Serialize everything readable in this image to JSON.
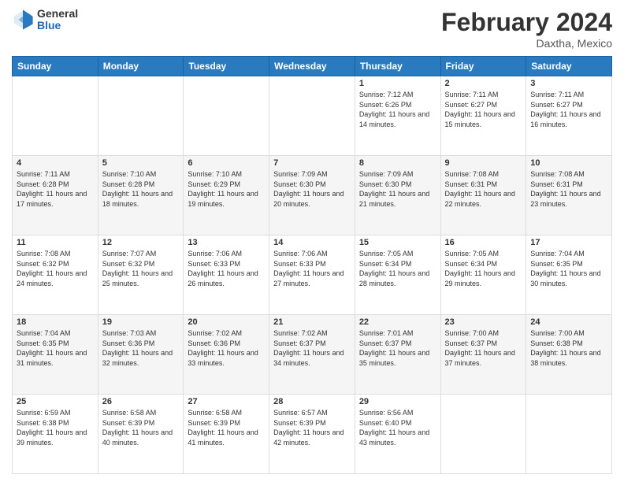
{
  "header": {
    "logo": {
      "general": "General",
      "blue": "Blue"
    },
    "title": "February 2024",
    "location": "Daxtha, Mexico"
  },
  "days_of_week": [
    "Sunday",
    "Monday",
    "Tuesday",
    "Wednesday",
    "Thursday",
    "Friday",
    "Saturday"
  ],
  "weeks": [
    [
      {
        "day": "",
        "info": ""
      },
      {
        "day": "",
        "info": ""
      },
      {
        "day": "",
        "info": ""
      },
      {
        "day": "",
        "info": ""
      },
      {
        "day": "1",
        "info": "Sunrise: 7:12 AM\nSunset: 6:26 PM\nDaylight: 11 hours and 14 minutes."
      },
      {
        "day": "2",
        "info": "Sunrise: 7:11 AM\nSunset: 6:27 PM\nDaylight: 11 hours and 15 minutes."
      },
      {
        "day": "3",
        "info": "Sunrise: 7:11 AM\nSunset: 6:27 PM\nDaylight: 11 hours and 16 minutes."
      }
    ],
    [
      {
        "day": "4",
        "info": "Sunrise: 7:11 AM\nSunset: 6:28 PM\nDaylight: 11 hours and 17 minutes."
      },
      {
        "day": "5",
        "info": "Sunrise: 7:10 AM\nSunset: 6:28 PM\nDaylight: 11 hours and 18 minutes."
      },
      {
        "day": "6",
        "info": "Sunrise: 7:10 AM\nSunset: 6:29 PM\nDaylight: 11 hours and 19 minutes."
      },
      {
        "day": "7",
        "info": "Sunrise: 7:09 AM\nSunset: 6:30 PM\nDaylight: 11 hours and 20 minutes."
      },
      {
        "day": "8",
        "info": "Sunrise: 7:09 AM\nSunset: 6:30 PM\nDaylight: 11 hours and 21 minutes."
      },
      {
        "day": "9",
        "info": "Sunrise: 7:08 AM\nSunset: 6:31 PM\nDaylight: 11 hours and 22 minutes."
      },
      {
        "day": "10",
        "info": "Sunrise: 7:08 AM\nSunset: 6:31 PM\nDaylight: 11 hours and 23 minutes."
      }
    ],
    [
      {
        "day": "11",
        "info": "Sunrise: 7:08 AM\nSunset: 6:32 PM\nDaylight: 11 hours and 24 minutes."
      },
      {
        "day": "12",
        "info": "Sunrise: 7:07 AM\nSunset: 6:32 PM\nDaylight: 11 hours and 25 minutes."
      },
      {
        "day": "13",
        "info": "Sunrise: 7:06 AM\nSunset: 6:33 PM\nDaylight: 11 hours and 26 minutes."
      },
      {
        "day": "14",
        "info": "Sunrise: 7:06 AM\nSunset: 6:33 PM\nDaylight: 11 hours and 27 minutes."
      },
      {
        "day": "15",
        "info": "Sunrise: 7:05 AM\nSunset: 6:34 PM\nDaylight: 11 hours and 28 minutes."
      },
      {
        "day": "16",
        "info": "Sunrise: 7:05 AM\nSunset: 6:34 PM\nDaylight: 11 hours and 29 minutes."
      },
      {
        "day": "17",
        "info": "Sunrise: 7:04 AM\nSunset: 6:35 PM\nDaylight: 11 hours and 30 minutes."
      }
    ],
    [
      {
        "day": "18",
        "info": "Sunrise: 7:04 AM\nSunset: 6:35 PM\nDaylight: 11 hours and 31 minutes."
      },
      {
        "day": "19",
        "info": "Sunrise: 7:03 AM\nSunset: 6:36 PM\nDaylight: 11 hours and 32 minutes."
      },
      {
        "day": "20",
        "info": "Sunrise: 7:02 AM\nSunset: 6:36 PM\nDaylight: 11 hours and 33 minutes."
      },
      {
        "day": "21",
        "info": "Sunrise: 7:02 AM\nSunset: 6:37 PM\nDaylight: 11 hours and 34 minutes."
      },
      {
        "day": "22",
        "info": "Sunrise: 7:01 AM\nSunset: 6:37 PM\nDaylight: 11 hours and 35 minutes."
      },
      {
        "day": "23",
        "info": "Sunrise: 7:00 AM\nSunset: 6:37 PM\nDaylight: 11 hours and 37 minutes."
      },
      {
        "day": "24",
        "info": "Sunrise: 7:00 AM\nSunset: 6:38 PM\nDaylight: 11 hours and 38 minutes."
      }
    ],
    [
      {
        "day": "25",
        "info": "Sunrise: 6:59 AM\nSunset: 6:38 PM\nDaylight: 11 hours and 39 minutes."
      },
      {
        "day": "26",
        "info": "Sunrise: 6:58 AM\nSunset: 6:39 PM\nDaylight: 11 hours and 40 minutes."
      },
      {
        "day": "27",
        "info": "Sunrise: 6:58 AM\nSunset: 6:39 PM\nDaylight: 11 hours and 41 minutes."
      },
      {
        "day": "28",
        "info": "Sunrise: 6:57 AM\nSunset: 6:39 PM\nDaylight: 11 hours and 42 minutes."
      },
      {
        "day": "29",
        "info": "Sunrise: 6:56 AM\nSunset: 6:40 PM\nDaylight: 11 hours and 43 minutes."
      },
      {
        "day": "",
        "info": ""
      },
      {
        "day": "",
        "info": ""
      }
    ]
  ]
}
